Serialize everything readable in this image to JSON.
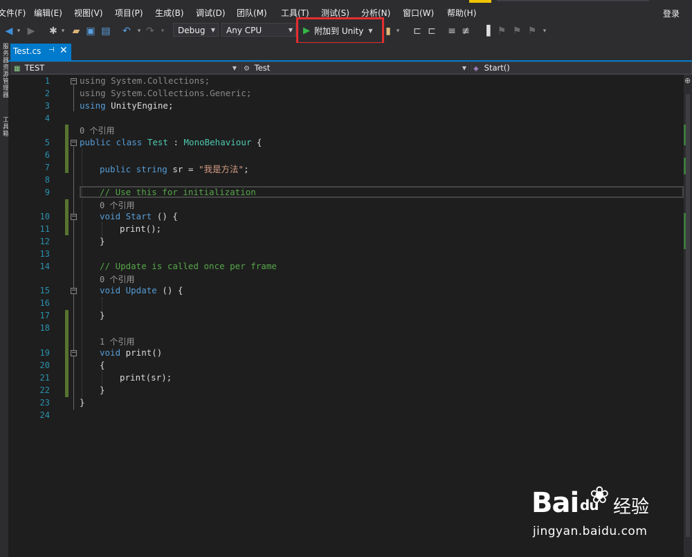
{
  "menu": [
    "文件(F)",
    "编辑(E)",
    "视图(V)",
    "项目(P)",
    "生成(B)",
    "调试(D)",
    "团队(M)",
    "工具(T)",
    "测试(S)",
    "分析(N)",
    "窗口(W)",
    "帮助(H)"
  ],
  "login": "登录",
  "toolbar": {
    "config": "Debug",
    "platform": "Any CPU",
    "attach": "附加到 Unity"
  },
  "left_strip": [
    "服务器资源管理器",
    "工具箱"
  ],
  "tab": {
    "name": "Test.cs",
    "pin": "⊣",
    "close": "✕"
  },
  "nav": {
    "project": "TEST",
    "class": "Test",
    "member": "Start()"
  },
  "editor": {
    "line_numbers": [
      "1",
      "2",
      "3",
      "4",
      "5",
      "6",
      "7",
      "8",
      "9",
      "10",
      "11",
      "12",
      "13",
      "14",
      "15",
      "16",
      "17",
      "18",
      "19",
      "20",
      "21",
      "22",
      "23",
      "24"
    ],
    "lines": {
      "l1_kw": "using",
      "l1_rest": " System.Collections;",
      "l2_kw": "using",
      "l2_rest": " System.Collections.Generic;",
      "l3_kw": "using",
      "l3_rest": " UnityEngine;",
      "l5_kw": "public class",
      "l5_name": " Test",
      "l5_colon": " : ",
      "l5_base": "MonoBehaviour",
      "l5_brace": " {",
      "l7_kw": "public string",
      "l7_rest": " sr = ",
      "l7_str": "\"我是方法\"",
      "l7_end": ";",
      "l9_cm": "// Use this for initialization",
      "l10_kw": "void",
      "l10_name": " Start",
      "l10_rest": " () {",
      "l11": "print();",
      "l12": "}",
      "l14_cm": "// Update is called once per frame",
      "l15_kw": "void",
      "l15_name": " Update",
      "l15_rest": " () {",
      "l17": "}",
      "l19_kw": "void",
      "l19_rest": " print()",
      "l20": "{",
      "l21": "print(sr);",
      "l22": "}",
      "l23": "}"
    },
    "codelens": {
      "class_refs": "0 个引用",
      "start_refs": "0 个引用",
      "update_refs": "0 个引用",
      "print_refs": "1 个引用"
    }
  },
  "watermark": {
    "logo": "Bai",
    "logo2": "du",
    "cn": "经验",
    "url": "jingyan.baidu.com"
  }
}
